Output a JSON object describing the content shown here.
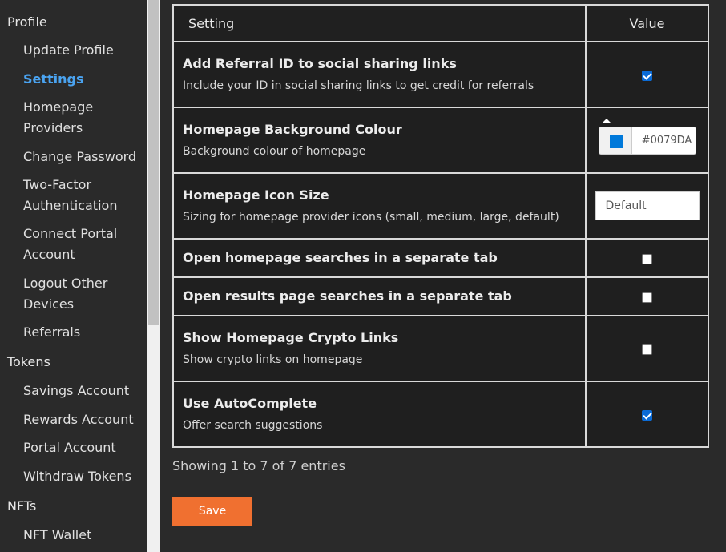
{
  "sidebar": {
    "sections": [
      {
        "label": "Profile"
      },
      {
        "label": "Tokens"
      },
      {
        "label": "NFTs"
      }
    ],
    "items": [
      {
        "label": "Update Profile"
      },
      {
        "label": "Settings"
      },
      {
        "label": "Homepage Providers"
      },
      {
        "label": "Change Password"
      },
      {
        "label": "Two-Factor Authentication"
      },
      {
        "label": "Connect Portal Account"
      },
      {
        "label": "Logout Other Devices"
      },
      {
        "label": "Referrals"
      },
      {
        "label": "Savings Account"
      },
      {
        "label": "Rewards Account"
      },
      {
        "label": "Portal Account"
      },
      {
        "label": "Withdraw Tokens"
      },
      {
        "label": "NFT Wallet"
      }
    ]
  },
  "table": {
    "headers": {
      "setting": "Setting",
      "value": "Value"
    },
    "rows": [
      {
        "title": "Add Referral ID to social sharing links",
        "desc": "Include your ID in social sharing links to get credit for referrals",
        "control": "checkbox",
        "checked": true
      },
      {
        "title": "Homepage Background Colour",
        "desc": "Background colour of homepage",
        "control": "color",
        "value": "#0079DA",
        "swatch_color": "#0079DA"
      },
      {
        "title": "Homepage Icon Size",
        "desc": "Sizing for homepage provider icons (small, medium, large, default)",
        "control": "text",
        "placeholder": "Default"
      },
      {
        "title": "Open homepage searches in a separate tab",
        "desc": "",
        "control": "checkbox",
        "checked": false
      },
      {
        "title": "Open results page searches in a separate tab",
        "desc": "",
        "control": "checkbox",
        "checked": false
      },
      {
        "title": "Show Homepage Crypto Links",
        "desc": "Show crypto links on homepage",
        "control": "checkbox",
        "checked": false
      },
      {
        "title": "Use AutoComplete",
        "desc": "Offer search suggestions",
        "control": "checkbox",
        "checked": true
      }
    ]
  },
  "entries_info": "Showing 1 to 7 of 7 entries",
  "save_label": "Save",
  "colors": {
    "accent": "#f07030",
    "active_link": "#4aa3f0",
    "checkbox": "#0b6bd6"
  }
}
